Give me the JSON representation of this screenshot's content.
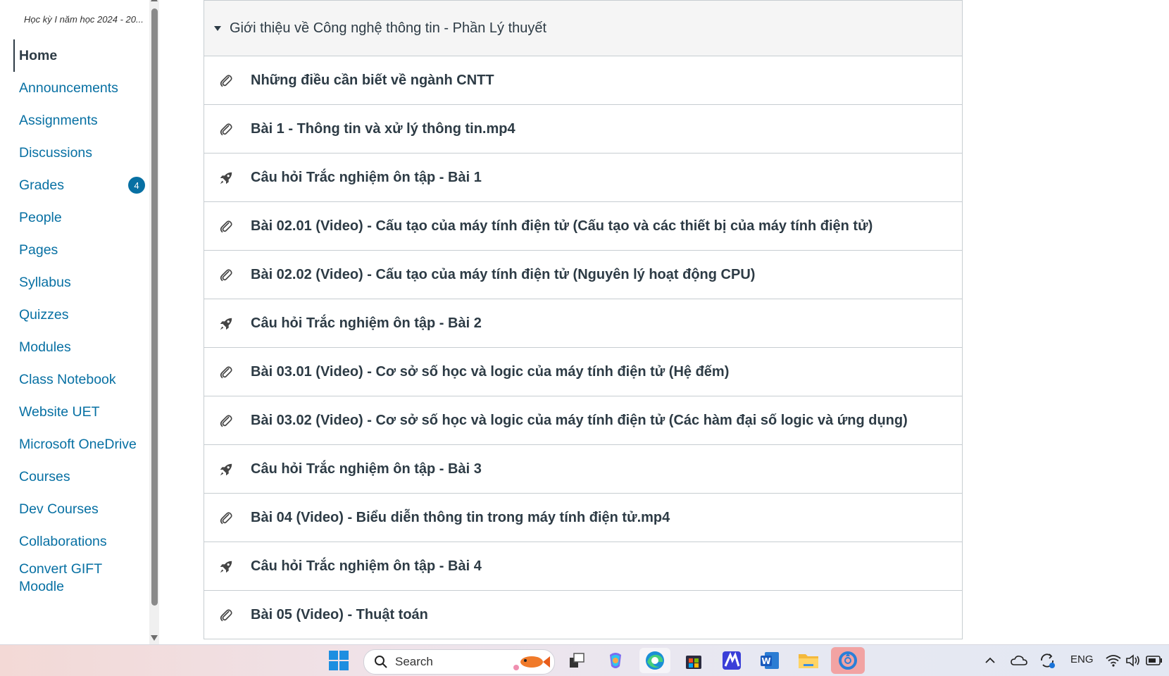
{
  "course": {
    "title": "Học kỳ I năm học 2024 - 20..."
  },
  "nav": {
    "items": [
      {
        "label": "Home",
        "active": true
      },
      {
        "label": "Announcements"
      },
      {
        "label": "Assignments"
      },
      {
        "label": "Discussions"
      },
      {
        "label": "Grades",
        "badge": "4"
      },
      {
        "label": "People"
      },
      {
        "label": "Pages"
      },
      {
        "label": "Syllabus"
      },
      {
        "label": "Quizzes"
      },
      {
        "label": "Modules"
      },
      {
        "label": "Class Notebook"
      },
      {
        "label": "Website UET"
      },
      {
        "label": "Microsoft OneDrive"
      },
      {
        "label": "Courses"
      },
      {
        "label": "Dev Courses"
      },
      {
        "label": "Collaborations"
      },
      {
        "label": "Convert GIFT Moodle"
      }
    ]
  },
  "module": {
    "header": "Giới thiệu về Công nghệ thông tin - Phần Lý thuyết",
    "items": [
      {
        "icon": "attachment-icon",
        "title": "Những điều cần biết về ngành CNTT"
      },
      {
        "icon": "attachment-icon",
        "title": "Bài 1 - Thông tin và xử lý thông tin.mp4"
      },
      {
        "icon": "quiz-rocket-icon",
        "title": "Câu hỏi Trắc nghiệm ôn tập - Bài 1"
      },
      {
        "icon": "attachment-icon",
        "title": "Bài 02.01 (Video) - Cấu tạo của máy tính điện tử (Cấu tạo và các thiết bị của máy tính điện tử)"
      },
      {
        "icon": "attachment-icon",
        "title": "Bài 02.02 (Video) - Cấu tạo của máy tính điện tử (Nguyên lý hoạt động CPU)"
      },
      {
        "icon": "quiz-rocket-icon",
        "title": "Câu hỏi Trắc nghiệm ôn tập - Bài 2"
      },
      {
        "icon": "attachment-icon",
        "title": "Bài 03.01 (Video) - Cơ sở số học và logic của máy tính điện tử (Hệ đếm)"
      },
      {
        "icon": "attachment-icon",
        "title": "Bài 03.02 (Video) - Cơ sở số học và logic của máy tính điện tử (Các hàm đại số logic và ứng dụng)"
      },
      {
        "icon": "quiz-rocket-icon",
        "title": "Câu hỏi Trắc nghiệm ôn tập - Bài 3"
      },
      {
        "icon": "attachment-icon",
        "title": "Bài 04 (Video) - Biểu diễn thông tin trong máy tính điện tử.mp4"
      },
      {
        "icon": "quiz-rocket-icon",
        "title": "Câu hỏi Trắc nghiệm ôn tập - Bài 4"
      },
      {
        "icon": "attachment-icon",
        "title": "Bài 05 (Video) - Thuật toán"
      }
    ]
  },
  "taskbar": {
    "search_placeholder": "Search",
    "language": "ENG",
    "apps": [
      "windows-start-icon",
      "search-icon",
      "task-view-icon",
      "copilot-icon",
      "edge-icon",
      "store-icon",
      "app-icon",
      "word-icon",
      "file-explorer-icon",
      "active-app-icon"
    ],
    "tray": [
      "chevron-up-icon",
      "onedrive-icon",
      "sync-icon",
      "wifi-icon",
      "volume-icon",
      "battery-icon"
    ]
  },
  "colors": {
    "link": "#0770a3",
    "text": "#2d3b45",
    "badge": "#0770a3",
    "border": "#c7cdd1"
  }
}
